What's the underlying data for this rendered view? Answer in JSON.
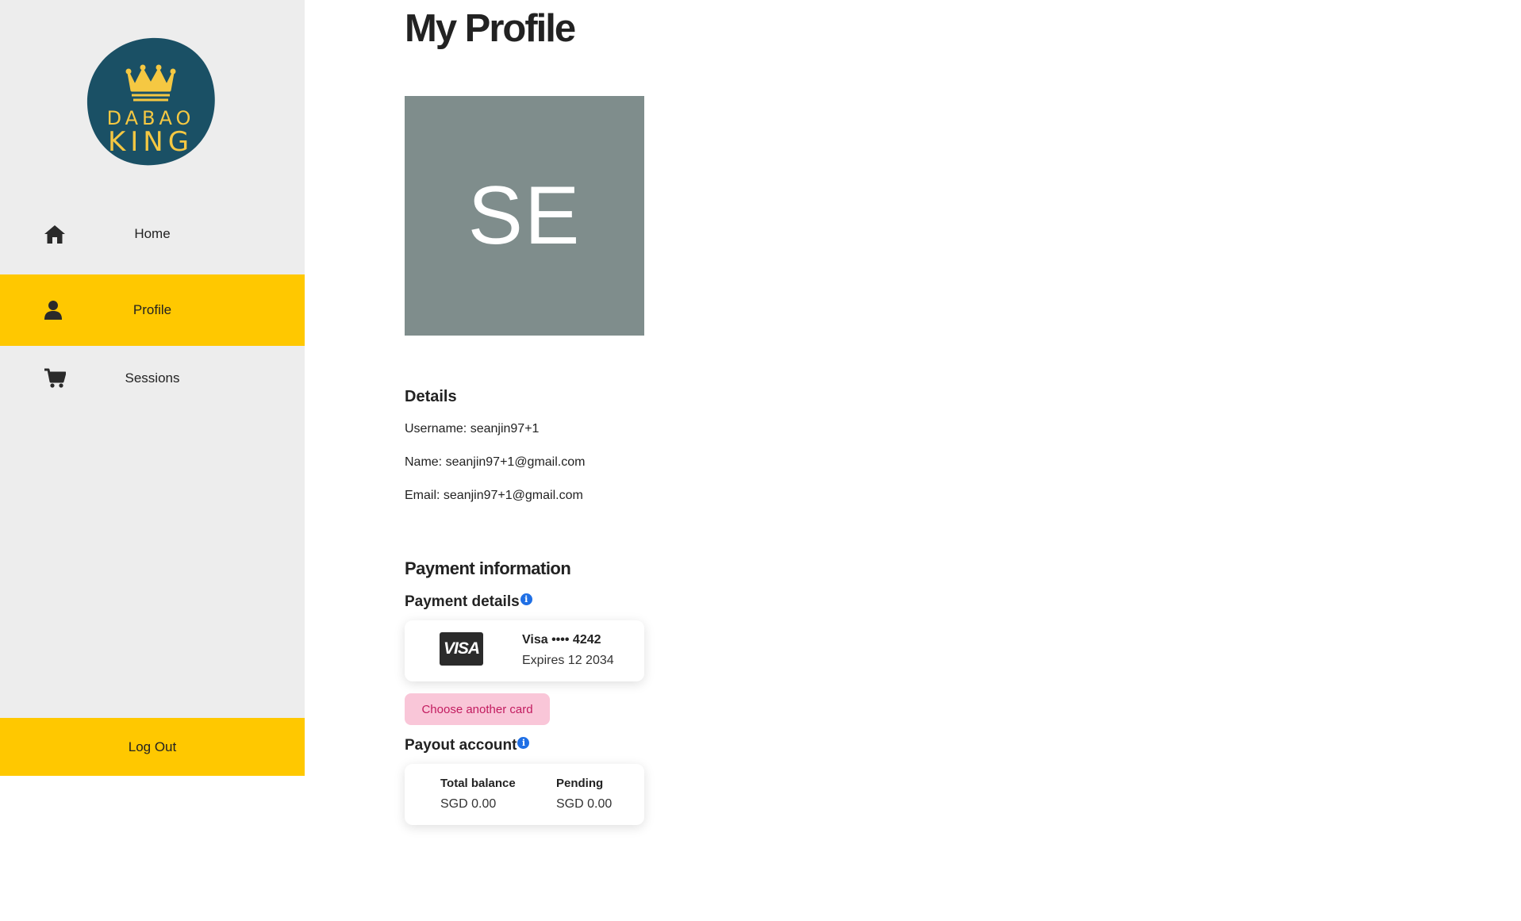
{
  "sidebar": {
    "logo": {
      "line1": "DABAO",
      "line2": "KING",
      "bg_color": "#1a5065",
      "text_color": "#f5c842"
    },
    "items": [
      {
        "label": "Home",
        "icon": "home-icon",
        "active": false
      },
      {
        "label": "Profile",
        "icon": "user-icon",
        "active": true
      },
      {
        "label": "Sessions",
        "icon": "cart-icon",
        "active": false
      }
    ],
    "logout_label": "Log Out"
  },
  "main": {
    "title": "My Profile",
    "avatar": {
      "initials": "SE",
      "bg_color": "#7f8d8c"
    },
    "details": {
      "heading": "Details",
      "username": "Username: seanjin97+1",
      "name": "Name: seanjin97+1@gmail.com",
      "email": "Email: seanjin97+1@gmail.com"
    },
    "payment": {
      "heading": "Payment information",
      "details_heading": "Payment details",
      "card": {
        "brand_badge": "VISA",
        "title": "Visa •••• 4242",
        "expiry": "Expires 12 2034"
      },
      "choose_card_label": "Choose another card",
      "payout_heading": "Payout account",
      "payout": {
        "total_label": "Total balance",
        "total_value": "SGD 0.00",
        "pending_label": "Pending",
        "pending_value": "SGD 0.00"
      },
      "info_glyph": "i"
    }
  },
  "colors": {
    "accent": "#ffc800",
    "sidebar_bg": "#ededed",
    "info_blue": "#1f6fe5",
    "button_bg": "#f9c6d8",
    "button_text": "#c21b5f"
  }
}
